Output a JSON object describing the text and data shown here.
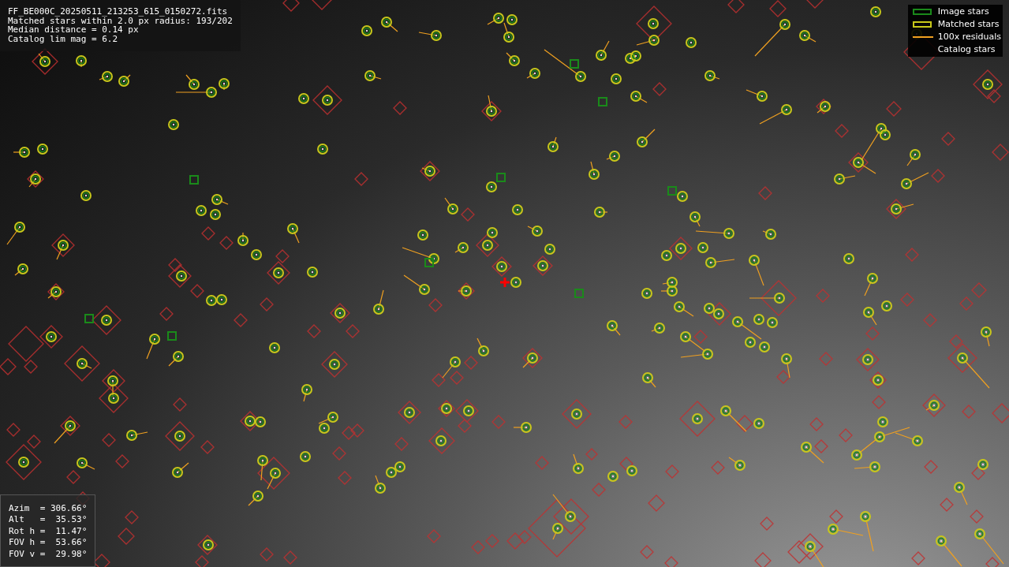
{
  "info_box": {
    "lines": [
      "FF_BE000C_20250511_213253_615_0150272.fits",
      "Matched stars within 2.0 px radius: 193/202",
      "Median distance = 0.14 px",
      "Catalog lim mag = 6.2"
    ]
  },
  "legend": [
    {
      "kind": "box",
      "label": "Image stars",
      "color": "#1a8a1a"
    },
    {
      "kind": "box",
      "label": "Matched stars",
      "color": "#c8c81a"
    },
    {
      "kind": "line",
      "label": "100x residuals",
      "color": "#f0a020"
    },
    {
      "kind": "none",
      "label": "Catalog stars"
    }
  ],
  "pointing_box": {
    "lines": [
      "Azim  = 306.66°",
      "Alt   =  35.53°",
      "Rot h =  11.47°",
      "FOV h =  53.66°",
      "FOV v =  29.98°"
    ]
  }
}
